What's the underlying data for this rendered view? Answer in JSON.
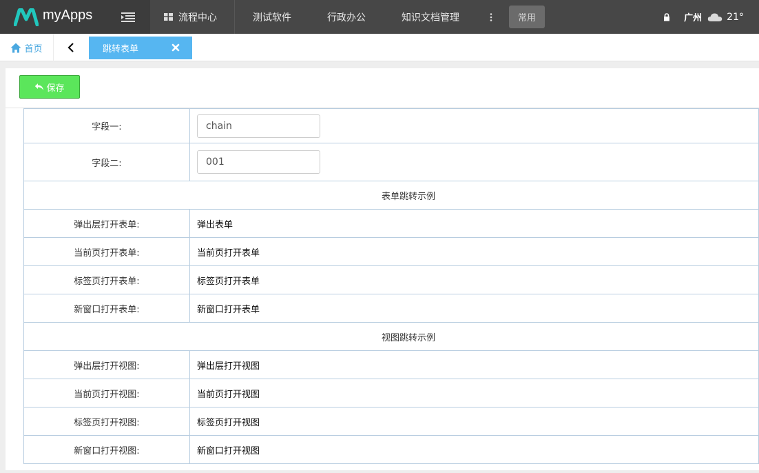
{
  "app": {
    "name": "myApps",
    "brand_color": "#21c7bd"
  },
  "nav": {
    "items": [
      "流程中心",
      "测试软件",
      "行政办公",
      "知识文档管理"
    ],
    "more_icon": "vertical-ellipsis-icon",
    "common_label": "常用"
  },
  "top_right": {
    "city": "广州",
    "weather_icon": "cloud-icon",
    "temperature": "21°"
  },
  "tabs": {
    "home_label": "首页",
    "active_label": "跳转表单"
  },
  "toolbar": {
    "save_label": "保存"
  },
  "form": {
    "field1_label": "字段一:",
    "field1_value": "chain",
    "field2_label": "字段二:",
    "field2_value": "001",
    "section1_title": "表单跳转示例",
    "form_rows": [
      {
        "label": "弹出层打开表单:",
        "value": "弹出表单"
      },
      {
        "label": "当前页打开表单:",
        "value": "当前页打开表单"
      },
      {
        "label": "标签页打开表单:",
        "value": "标签页打开表单"
      },
      {
        "label": "新窗口打开表单:",
        "value": "新窗口打开表单"
      }
    ],
    "section2_title": "视图跳转示例",
    "view_rows": [
      {
        "label": "弹出层打开视图:",
        "value": "弹出层打开视图"
      },
      {
        "label": "当前页打开视图:",
        "value": "当前页打开视图"
      },
      {
        "label": "标签页打开视图:",
        "value": "标签页打开视图"
      },
      {
        "label": "新窗口打开视图:",
        "value": "新窗口打开视图"
      }
    ]
  }
}
